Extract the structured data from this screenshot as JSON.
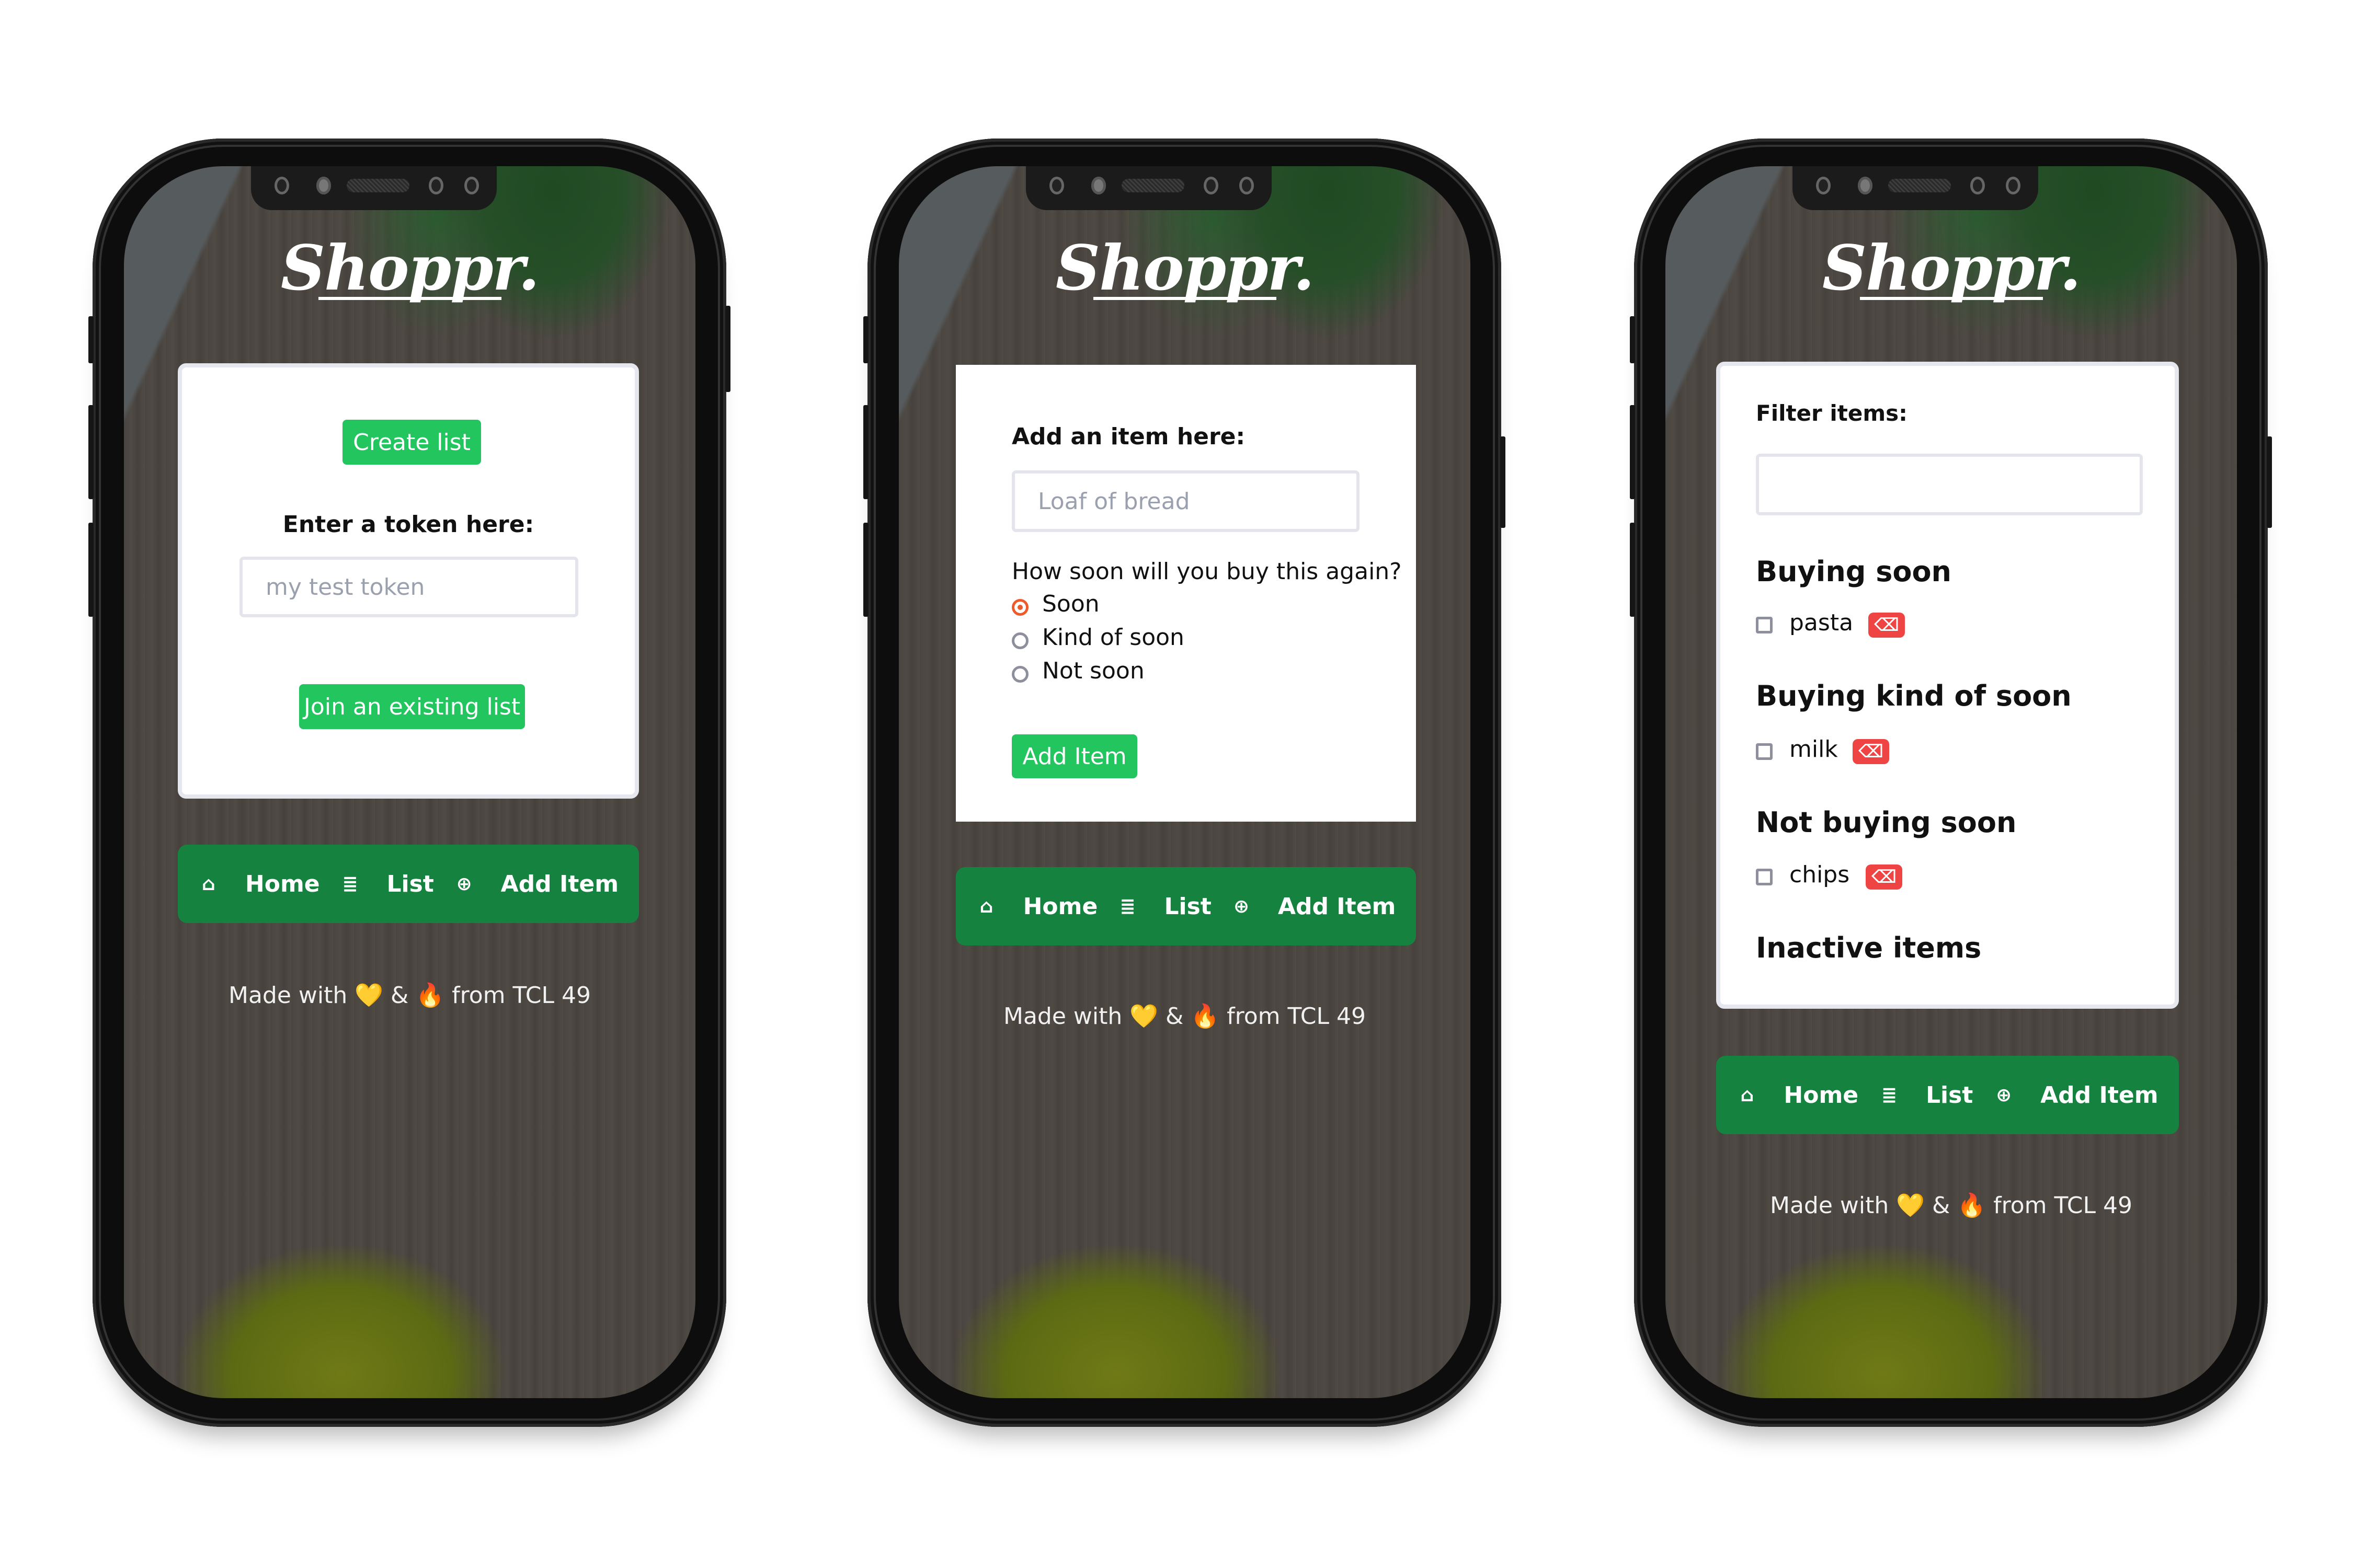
{
  "app": {
    "logo": "Shoppr.",
    "footer": "Made with 💛 & 🔥 from TCL 49",
    "colors": {
      "primary_button": "#22c55e",
      "nav_bar": "#16823f",
      "delete_button": "#ef4444",
      "radio_selected": "#ef5a2a"
    }
  },
  "nav": {
    "items": [
      {
        "icon": "home-icon",
        "glyph": "⌂",
        "label": "Home"
      },
      {
        "icon": "list-icon",
        "glyph": "≣",
        "label": "List"
      },
      {
        "icon": "add-circle-icon",
        "glyph": "⊕",
        "label": "Add Item"
      }
    ]
  },
  "screens": {
    "home": {
      "create_button": "Create list",
      "token_label": "Enter a token here:",
      "token_placeholder": "my test token",
      "join_button": "Join an existing list"
    },
    "add_item": {
      "item_label": "Add an item here:",
      "item_placeholder": "Loaf of bread",
      "frequency_question": "How soon will you buy this again?",
      "options": [
        {
          "label": "Soon",
          "checked": true
        },
        {
          "label": "Kind of soon",
          "checked": false
        },
        {
          "label": "Not soon",
          "checked": false
        }
      ],
      "submit_button": "Add Item"
    },
    "list": {
      "filter_label": "Filter items:",
      "filter_value": "",
      "sections": [
        {
          "title": "Buying soon",
          "items": [
            {
              "name": "pasta",
              "checked": false
            }
          ]
        },
        {
          "title": "Buying kind of soon",
          "items": [
            {
              "name": "milk",
              "checked": false
            }
          ]
        },
        {
          "title": "Not buying soon",
          "items": [
            {
              "name": "chips",
              "checked": false
            }
          ]
        },
        {
          "title": "Inactive items",
          "items": []
        }
      ],
      "delete_glyph": "⌫"
    }
  }
}
